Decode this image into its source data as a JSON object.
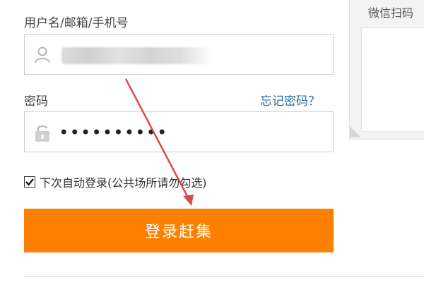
{
  "login": {
    "username_label": "用户名/邮箱/手机号",
    "password_label": "密码",
    "forgot_password": "忘记密码？",
    "password_masked": "••••••••••",
    "remember_label": "下次自动登录(公共场所请勿勾选)",
    "remember_checked": true,
    "submit_label": "登录赶集"
  },
  "qr_panel": {
    "title": "微信扫码"
  },
  "icons": {
    "user": "user-icon",
    "lock": "lock-icon",
    "check": "checkmark-icon"
  },
  "colors": {
    "accent": "#ff8000",
    "link": "#2a6ea0",
    "annotation_arrow": "#d94b4b"
  }
}
